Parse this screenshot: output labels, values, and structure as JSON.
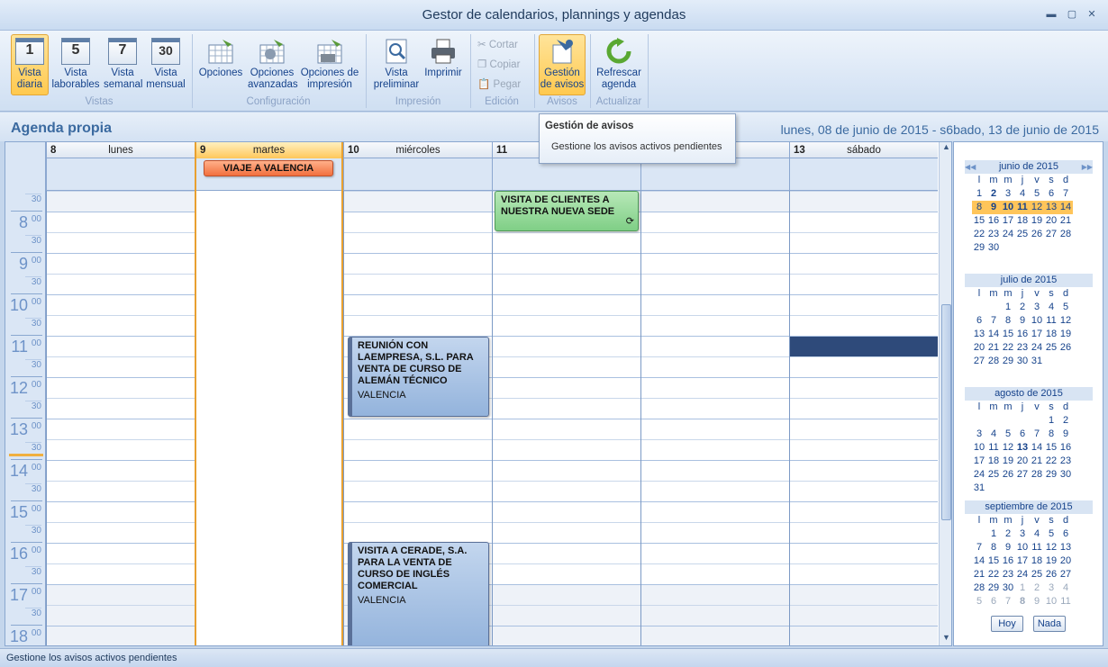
{
  "window": {
    "title": "Gestor de calendarios, plannings y agendas",
    "min": "▬",
    "restore": "▢",
    "close": "✕"
  },
  "ribbon": {
    "vistas": [
      {
        "num": "1",
        "l1": "Vista",
        "l2": "diaria"
      },
      {
        "num": "5",
        "l1": "Vista",
        "l2": "laborables"
      },
      {
        "num": "7",
        "l1": "Vista",
        "l2": "semanal"
      },
      {
        "num": "30",
        "l1": "Vista",
        "l2": "mensual"
      }
    ],
    "config": [
      {
        "l1": "Opciones",
        "l2": ""
      },
      {
        "l1": "Opciones",
        "l2": "avanzadas"
      },
      {
        "l1": "Opciones de",
        "l2": "impresión"
      }
    ],
    "print": [
      {
        "l1": "Vista",
        "l2": "preliminar"
      },
      {
        "l1": "Imprimir",
        "l2": ""
      }
    ],
    "edit": {
      "cut": "Cortar",
      "copy": "Copiar",
      "paste": "Pegar"
    },
    "avisos": {
      "l1": "Gestión",
      "l2": "de avisos"
    },
    "refresh": {
      "l1": "Refrescar",
      "l2": "agenda"
    },
    "groups": {
      "vistas": "Vistas",
      "config": "Configuración",
      "impresion": "Impresión",
      "edicion": "Edición",
      "avisos": "Avisos",
      "actualizar": "Actualizar"
    }
  },
  "agenda": {
    "title": "Agenda propia",
    "range": "lunes, 08 de junio de 2015 - s6bado, 13 de junio de 2015"
  },
  "tooltip": {
    "title": "Gestión de avisos",
    "desc": "Gestione los avisos activos pendientes"
  },
  "days": [
    {
      "n": "8",
      "w": "lunes"
    },
    {
      "n": "9",
      "w": "martes"
    },
    {
      "n": "10",
      "w": "miércoles"
    },
    {
      "n": "11",
      "w": ""
    },
    {
      "n": "",
      "w": ""
    },
    {
      "n": "13",
      "w": "sábado"
    }
  ],
  "hours": [
    {
      "h": "",
      "m": "",
      "half": "30"
    },
    {
      "h": "8",
      "m": "00",
      "half": "30"
    },
    {
      "h": "9",
      "m": "00",
      "half": "30"
    },
    {
      "h": "10",
      "m": "00",
      "half": "30"
    },
    {
      "h": "11",
      "m": "00",
      "half": "30"
    },
    {
      "h": "12",
      "m": "00",
      "half": "30"
    },
    {
      "h": "13",
      "m": "00",
      "half": "30"
    },
    {
      "h": "14",
      "m": "00",
      "half": "30"
    },
    {
      "h": "15",
      "m": "00",
      "half": "30"
    },
    {
      "h": "16",
      "m": "00",
      "half": "30"
    },
    {
      "h": "17",
      "m": "00",
      "half": "30"
    },
    {
      "h": "18",
      "m": "00",
      "half": ""
    }
  ],
  "events": {
    "allday": "VIAJE A VALENCIA",
    "visita_clientes": "VISITA DE CLIENTES A NUESTRA NUEVA SEDE",
    "reunion": "REUNIÓN CON LAEMPRESA, S.L. PARA VENTA DE CURSO DE ALEMÁN TÉCNICO",
    "reunion_loc": "VALENCIA",
    "cerade": "VISITA A CERADE, S.A. PARA LA VENTA DE CURSO DE INGLÉS COMERCIAL",
    "cerade_loc": "VALENCIA",
    "recurring_icon": "⟳"
  },
  "minical": {
    "weekdays": [
      "l",
      "m",
      "m",
      "j",
      "v",
      "s",
      "d"
    ],
    "months": [
      {
        "title": "junio de 2015",
        "rows": [
          [
            "1",
            "2",
            "3",
            "4",
            "5",
            "6",
            "7"
          ],
          [
            "8",
            "9",
            "10",
            "11",
            "12",
            "13",
            "14"
          ],
          [
            "15",
            "16",
            "17",
            "18",
            "19",
            "20",
            "21"
          ],
          [
            "22",
            "23",
            "24",
            "25",
            "26",
            "27",
            "28"
          ],
          [
            "29",
            "30",
            "",
            "",
            "",
            "",
            ""
          ]
        ]
      },
      {
        "title": "julio de 2015",
        "rows": [
          [
            "",
            "",
            "1",
            "2",
            "3",
            "4",
            "5"
          ],
          [
            "6",
            "7",
            "8",
            "9",
            "10",
            "11",
            "12"
          ],
          [
            "13",
            "14",
            "15",
            "16",
            "17",
            "18",
            "19"
          ],
          [
            "20",
            "21",
            "22",
            "23",
            "24",
            "25",
            "26"
          ],
          [
            "27",
            "28",
            "29",
            "30",
            "31",
            "",
            ""
          ]
        ]
      },
      {
        "title": "agosto de 2015",
        "rows": [
          [
            "",
            "",
            "",
            "",
            "",
            "1",
            "2"
          ],
          [
            "3",
            "4",
            "5",
            "6",
            "7",
            "8",
            "9"
          ],
          [
            "10",
            "11",
            "12",
            "13",
            "14",
            "15",
            "16"
          ],
          [
            "17",
            "18",
            "19",
            "20",
            "21",
            "22",
            "23"
          ],
          [
            "24",
            "25",
            "26",
            "27",
            "28",
            "29",
            "30"
          ],
          [
            "31",
            "",
            "",
            "",
            "",
            "",
            ""
          ]
        ]
      },
      {
        "title": "septiembre de 2015",
        "rows": [
          [
            "",
            "1",
            "2",
            "3",
            "4",
            "5",
            "6"
          ],
          [
            "7",
            "8",
            "9",
            "10",
            "11",
            "12",
            "13"
          ],
          [
            "14",
            "15",
            "16",
            "17",
            "18",
            "19",
            "20"
          ],
          [
            "21",
            "22",
            "23",
            "24",
            "25",
            "26",
            "27"
          ],
          [
            "28",
            "29",
            "30",
            "1",
            "2",
            "3",
            "4"
          ],
          [
            "5",
            "6",
            "7",
            "8",
            "9",
            "10",
            "11"
          ]
        ]
      }
    ],
    "today": "Hoy",
    "none": "Nada",
    "nav_prev": "◀◀",
    "nav_next": "▶▶"
  },
  "status": "Gestione los avisos activos pendientes"
}
